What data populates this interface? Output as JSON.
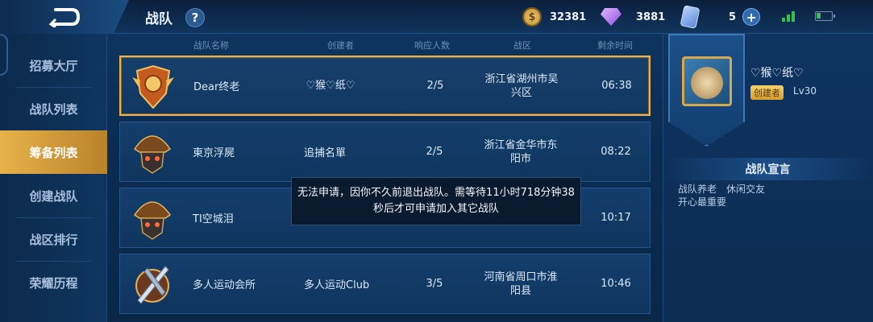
{
  "header": {
    "title": "战队",
    "help_label": "?",
    "gold": "32381",
    "diamonds": "3881",
    "cards": "5",
    "plus_label": "+",
    "coin_symbol": "$"
  },
  "sidebar": {
    "items": [
      {
        "label": "招募大厅"
      },
      {
        "label": "战队列表"
      },
      {
        "label": "筹备列表",
        "active": true
      },
      {
        "label": "创建战队"
      },
      {
        "label": "战区排行"
      },
      {
        "label": "荣耀历程"
      }
    ]
  },
  "table": {
    "columns": [
      "战队名称",
      "创建者",
      "响应人数",
      "战区",
      "剩余时间"
    ],
    "rows": [
      {
        "name": "Dear终老",
        "creator": "♡猴♡纸♡",
        "count": "2/5",
        "region": "浙江省湖州市吴兴区",
        "time": "06:38",
        "emblem": "dragon-emblem",
        "selected": true
      },
      {
        "name": "東京浮屍",
        "creator": "追捕名單",
        "count": "2/5",
        "region": "浙江省金华市东阳市",
        "time": "08:22",
        "emblem": "skull-emblem"
      },
      {
        "name": "TI空城泪",
        "creator": "",
        "count": "",
        "region": "",
        "time": "10:17",
        "emblem": "skull-emblem"
      },
      {
        "name": "多人运动会所",
        "creator": "多人运动Club",
        "count": "3/5",
        "region": "河南省周口市淮阳县",
        "time": "10:46",
        "emblem": "sword-emblem"
      }
    ]
  },
  "toast": {
    "message": "无法申请，因你不久前退出战队。需等待11小时718分钟38秒后才可申请加入其它战队"
  },
  "right_panel": {
    "name": "♡猴♡纸♡",
    "creator_badge": "创建者",
    "level": "Lv30",
    "declaration_title": "战队宣言",
    "declaration_text": "战队养老　休闲交友\n开心最重要"
  },
  "colors": {
    "accent_gold": "#e2b35b",
    "active_tab": "#e8b24a",
    "signal": "#35c24a"
  }
}
